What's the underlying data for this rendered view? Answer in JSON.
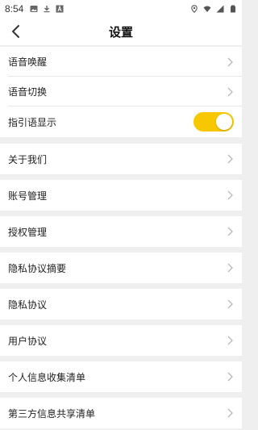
{
  "status_bar": {
    "time": "8:54",
    "left_icons": [
      "image-icon",
      "download-icon",
      "a-badge-icon"
    ],
    "right_icons": [
      "location-icon",
      "wifi-icon",
      "signal-icon",
      "battery-icon"
    ]
  },
  "header": {
    "title": "设置",
    "back_icon": "chevron-left-icon"
  },
  "settings": {
    "group1": [
      {
        "label": "语音唤醒"
      },
      {
        "label": "语音切换"
      },
      {
        "label": "指引语显示",
        "toggle": true
      }
    ],
    "about": "关于我们",
    "account": "账号管理",
    "authorization": "授权管理",
    "privacy_summary": "隐私协议摘要",
    "privacy": "隐私协议",
    "user_agreement": "用户协议",
    "personal_info_list": "个人信息收集清单",
    "third_party_list": "第三方信息共享清单"
  },
  "colors": {
    "toggle_on": "#f7c800",
    "chevron": "#b8b8b8",
    "page_bg": "#efefef"
  }
}
